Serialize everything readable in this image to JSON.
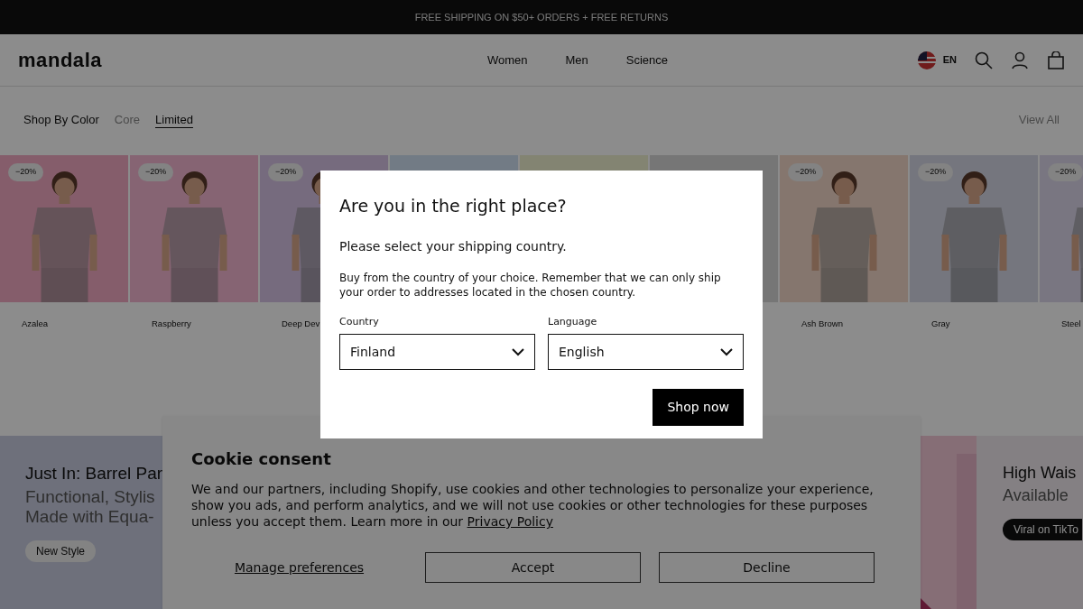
{
  "announcement": "FREE SHIPPING ON $50+ ORDERS + FREE RETURNS",
  "header": {
    "logo": "mandala",
    "nav": [
      {
        "label": "Women"
      },
      {
        "label": "Men"
      },
      {
        "label": "Science"
      }
    ],
    "language": "EN"
  },
  "filters": {
    "items": [
      {
        "label": "Shop By Color",
        "selected": false
      },
      {
        "label": "Core",
        "selected": false
      },
      {
        "label": "Limited",
        "selected": true
      }
    ],
    "view_all": "View All"
  },
  "products": [
    {
      "kind": "picture",
      "badge": "−20%",
      "name": "Azalea"
    },
    {
      "kind": "picture",
      "badge": "−20%",
      "name": "Raspberry"
    },
    {
      "kind": "picture",
      "badge": "−20%",
      "name": "Deep Dev"
    },
    {
      "kind": "picture"
    },
    {
      "kind": "picture"
    },
    {
      "kind": "picture"
    },
    {
      "kind": "picture",
      "badge": "−20%",
      "name": "Ash Brown"
    },
    {
      "kind": "picture",
      "badge": "−20%",
      "name": "Gray"
    },
    {
      "kind": "picture",
      "badge": "−20%",
      "name": "Steel"
    }
  ],
  "promos": [
    {
      "title": "Just In: Barrel Par",
      "subtitle_lines": [
        "Functional, Stylis",
        "Made with Equa-"
      ],
      "tag": "New Style"
    },
    {
      "title": "High Wais",
      "subtitle_lines": [
        "Available"
      ],
      "tag": "Viral on TikTo"
    }
  ],
  "cookie": {
    "title": "Cookie consent",
    "text": "We and our partners, including Shopify, use cookies and other technologies to personalize your experience, show you ads, and perform analytics, and we will not use cookies or other technologies for these purposes unless you accept them. Learn more in our",
    "link": "Privacy Policy",
    "buttons": [
      {
        "label": "Manage preferences",
        "kind": "link"
      },
      {
        "label": "Accept",
        "kind": "outline"
      },
      {
        "label": "Decline",
        "kind": "outline"
      }
    ]
  },
  "modal": {
    "title": "Are you in the right place?",
    "subtitle": "Please select your shipping country.",
    "text": "Buy from the country of your choice. Remember that we can only ship your order to addresses located in the chosen country.",
    "fields": [
      {
        "label": "Country",
        "value": "Finland"
      },
      {
        "label": "Language",
        "value": "English"
      }
    ],
    "button": "Shop now"
  }
}
